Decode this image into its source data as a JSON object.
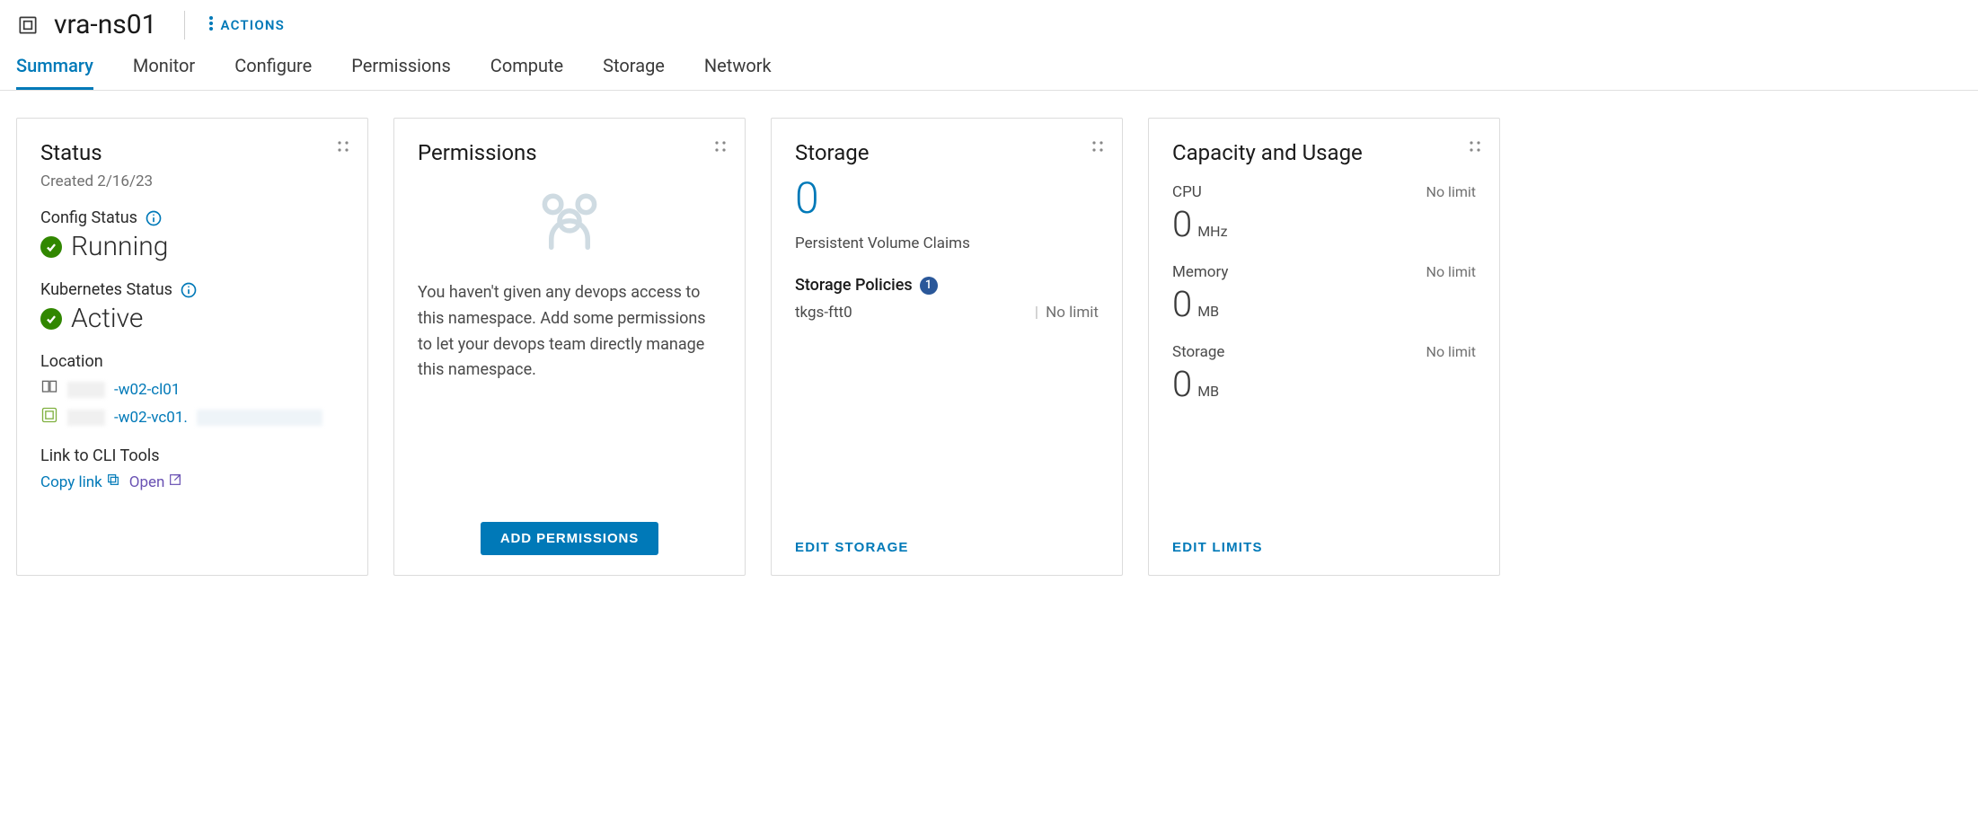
{
  "header": {
    "title": "vra-ns01",
    "actions_label": "ACTIONS"
  },
  "tabs": [
    {
      "label": "Summary",
      "active": true
    },
    {
      "label": "Monitor",
      "active": false
    },
    {
      "label": "Configure",
      "active": false
    },
    {
      "label": "Permissions",
      "active": false
    },
    {
      "label": "Compute",
      "active": false
    },
    {
      "label": "Storage",
      "active": false
    },
    {
      "label": "Network",
      "active": false
    }
  ],
  "status_card": {
    "title": "Status",
    "created_label": "Created 2/16/23",
    "config_status_label": "Config Status",
    "config_status_value": "Running",
    "kubernetes_status_label": "Kubernetes Status",
    "kubernetes_status_value": "Active",
    "location_label": "Location",
    "location_cluster": "-w02-cl01",
    "location_vc": "-w02-vc01.",
    "cli_label": "Link to CLI Tools",
    "copy_link_label": "Copy link",
    "open_label": "Open"
  },
  "permissions_card": {
    "title": "Permissions",
    "empty_text": "You haven't given any devops access to this namespace. Add some permissions to let your devops team directly manage this namespace.",
    "add_button": "ADD PERMISSIONS"
  },
  "storage_card": {
    "title": "Storage",
    "pvc_count": "0",
    "pvc_label": "Persistent Volume Claims",
    "policies_label": "Storage Policies",
    "policies_count": "1",
    "policy_name": "tkgs-ftt0",
    "policy_limit": "No limit",
    "edit_button": "EDIT STORAGE"
  },
  "capacity_card": {
    "title": "Capacity and Usage",
    "items": [
      {
        "label": "CPU",
        "value": "0",
        "unit": "MHz",
        "limit": "No limit"
      },
      {
        "label": "Memory",
        "value": "0",
        "unit": "MB",
        "limit": "No limit"
      },
      {
        "label": "Storage",
        "value": "0",
        "unit": "MB",
        "limit": "No limit"
      }
    ],
    "edit_button": "EDIT LIMITS"
  }
}
